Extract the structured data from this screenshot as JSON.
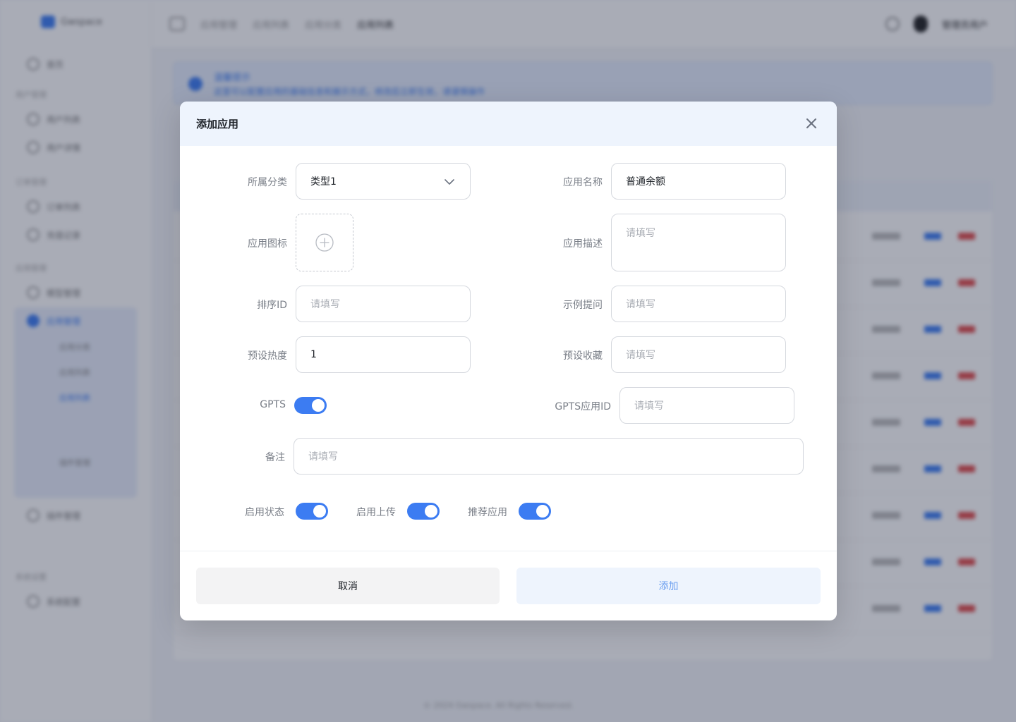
{
  "background_app": {
    "logo_text": "Gwspace",
    "side_groups": [
      "用户管理",
      "订单管理",
      "应用管理",
      "系统设置"
    ],
    "side_items": [
      "首页",
      "用户列表",
      "用户详情",
      "订单列表",
      "充值记录",
      "模型管理",
      "应用管理",
      "应用分类",
      "应用列表",
      "插件管理",
      "系统配置"
    ],
    "breadcrumbs": [
      "应用管理",
      "应用列表",
      "应用分类",
      "应用列表"
    ],
    "user_name": "管理员用户",
    "alert_title": "温馨提示",
    "alert_text": "这里可以配置应用的基础信息和展示方式，修改后立即生效，请谨慎操作",
    "footer": "© 2024 Gwspace. All Rights Reserved."
  },
  "modal": {
    "title": "添加应用",
    "fields": {
      "category": {
        "label": "所属分类",
        "value": "类型1"
      },
      "app_name": {
        "label": "应用名称",
        "value": "普通余额"
      },
      "app_icon": {
        "label": "应用图标"
      },
      "app_desc": {
        "label": "应用描述",
        "placeholder": "请填写"
      },
      "sort_id": {
        "label": "排序ID",
        "placeholder": "请填写"
      },
      "example_question": {
        "label": "示例提问",
        "placeholder": "请填写"
      },
      "preset_heat": {
        "label": "预设热度",
        "value": "1"
      },
      "preset_favorite": {
        "label": "预设收藏",
        "placeholder": "请填写"
      },
      "gpts": {
        "label": "GPTS",
        "on": true
      },
      "gpts_app_id": {
        "label": "GPTS应用ID",
        "placeholder": "请填写"
      },
      "remark": {
        "label": "备注",
        "placeholder": "请填写"
      },
      "enable_status": {
        "label": "启用状态",
        "on": true
      },
      "enable_upload": {
        "label": "启用上传",
        "on": true
      },
      "recommend_app": {
        "label": "推荐应用",
        "on": true
      }
    },
    "buttons": {
      "cancel": "取消",
      "add": "添加"
    }
  },
  "colors": {
    "accent": "#3c7cf2",
    "header_bg": "#eef4fd",
    "overlay": "rgba(28,36,62,0.38)"
  }
}
